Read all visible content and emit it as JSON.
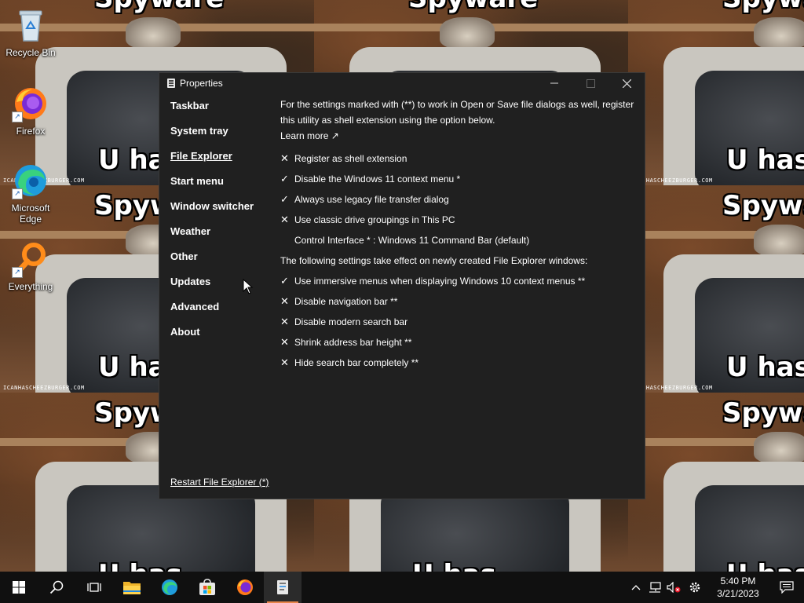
{
  "wallpaper": {
    "caption_top": "Spyware",
    "caption_bottom": "U has",
    "watermark": "ICANHASCHEEZBURGER.COM"
  },
  "desktop_icons": [
    {
      "label": "Recycle Bin",
      "icon": "recycle-bin-icon"
    },
    {
      "label": "Firefox",
      "icon": "firefox-icon"
    },
    {
      "label": "Microsoft Edge",
      "icon": "edge-icon"
    },
    {
      "label": "Everything",
      "icon": "everything-search-icon"
    }
  ],
  "window": {
    "title": "Properties",
    "nav": [
      {
        "label": "Taskbar",
        "active": false
      },
      {
        "label": "System tray",
        "active": false
      },
      {
        "label": "File Explorer",
        "active": true
      },
      {
        "label": "Start menu",
        "active": false
      },
      {
        "label": "Window switcher",
        "active": false
      },
      {
        "label": "Weather",
        "active": false
      },
      {
        "label": "Other",
        "active": false
      },
      {
        "label": "Updates",
        "active": false
      },
      {
        "label": "Advanced",
        "active": false
      },
      {
        "label": "About",
        "active": false
      }
    ],
    "intro": "For the settings marked with (**) to work in Open or Save file dialogs as well, register this utility as shell extension using the option below.",
    "learn_more": "Learn more ↗",
    "options_top": [
      {
        "mark": "✕",
        "label": "Register as shell extension"
      },
      {
        "mark": "✓",
        "label": "Disable the Windows 11 context menu *"
      },
      {
        "mark": "✓",
        "label": "Always use legacy file transfer dialog"
      },
      {
        "mark": "✕",
        "label": "Use classic drive groupings in This PC"
      }
    ],
    "control_interface": "Control Interface * : Windows 11 Command Bar (default)",
    "section_note": "The following settings take effect on newly created File Explorer windows:",
    "options_bottom": [
      {
        "mark": "✓",
        "label": "Use immersive menus when displaying Windows 10 context menus **"
      },
      {
        "mark": "✕",
        "label": "Disable navigation bar **"
      },
      {
        "mark": "✕",
        "label": "Disable modern search bar"
      },
      {
        "mark": "✕",
        "label": "Shrink address bar height **"
      },
      {
        "mark": "✕",
        "label": "Hide search bar completely **"
      }
    ],
    "restart_link": "Restart File Explorer (*)"
  },
  "taskbar": {
    "time": "5:40 PM",
    "date": "3/21/2023",
    "accent": "#e8854a"
  }
}
